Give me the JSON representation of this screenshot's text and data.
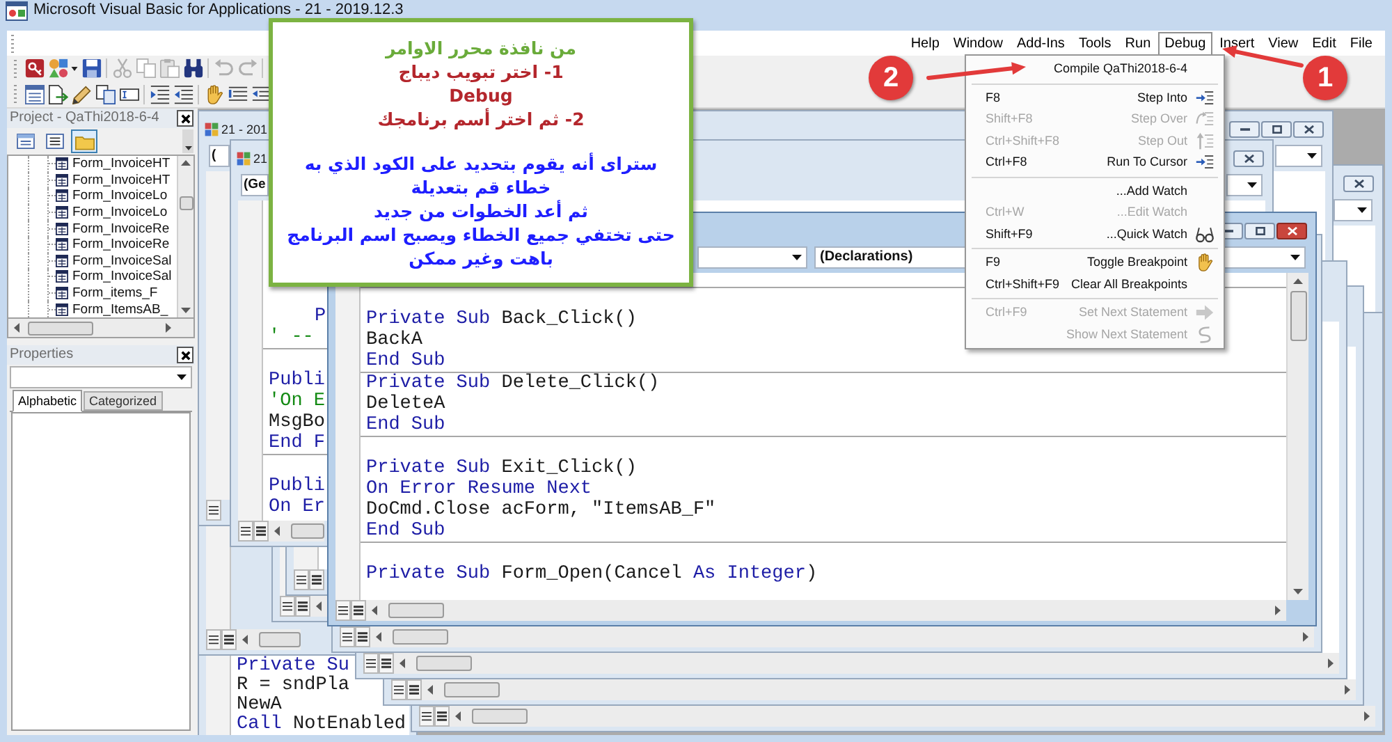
{
  "window": {
    "title": "Microsoft Visual Basic for Applications - 21 - 2019.12.3"
  },
  "menu_bar": [
    {
      "label": "Help",
      "selected": false
    },
    {
      "label": "Window",
      "selected": false
    },
    {
      "label": "Add-Ins",
      "selected": false
    },
    {
      "label": "Tools",
      "selected": false
    },
    {
      "label": "Run",
      "selected": false
    },
    {
      "label": "Debug",
      "selected": true
    },
    {
      "label": "Insert",
      "selected": false
    },
    {
      "label": "View",
      "selected": false
    },
    {
      "label": "Edit",
      "selected": false
    },
    {
      "label": "File",
      "selected": false
    }
  ],
  "toolbars": [
    [
      {
        "disabled": false
      },
      {
        "disabled": false,
        "dropdown": true
      },
      {
        "disabled": false
      },
      {
        "disabled": true
      },
      {
        "disabled": true
      },
      {
        "disabled": true
      },
      {
        "disabled": false
      },
      {
        "disabled": true
      },
      {
        "disabled": true
      }
    ],
    [
      {
        "disabled": false
      },
      {
        "disabled": false
      },
      {
        "disabled": false
      },
      {
        "disabled": false
      },
      {
        "disabled": false
      },
      {
        "disabled": false
      },
      {
        "disabled": false
      },
      {
        "disabled": false
      },
      {
        "disabled": false
      },
      {
        "disabled": false
      }
    ]
  ],
  "project": {
    "title": "Project - QaThi2018-6-4",
    "toolbar": [
      {
        "selected": false
      },
      {
        "selected": false
      },
      {
        "selected": true
      }
    ],
    "items": [
      "Form_InvoiceHT",
      "Form_InvoiceHT",
      "Form_InvoiceLo",
      "Form_InvoiceLo",
      "Form_InvoiceRe",
      "Form_InvoiceRe",
      "Form_InvoiceSal",
      "Form_InvoiceSal",
      "Form_items_F",
      "Form_ItemsAB_"
    ]
  },
  "properties": {
    "title": "Properties",
    "tabs": [
      {
        "label": "Alphabetic",
        "selected": true
      },
      {
        "label": "Categorized",
        "selected": false
      }
    ]
  },
  "code_windows": [
    {
      "title": "21 - 201",
      "active": false,
      "object_combo": "("
    },
    {
      "title": "21",
      "active": false,
      "object_combo": "(Ge",
      "lines": [
        {
          "kind": "code",
          "tokens": [
            {
              "kind": "keyword",
              "text": "P"
            }
          ]
        },
        {
          "kind": "code",
          "tokens": [
            {
              "kind": "comment",
              "text": "' --"
            }
          ]
        },
        {
          "kind": "separator"
        },
        {
          "kind": "blank"
        },
        {
          "kind": "code",
          "tokens": [
            {
              "kind": "keyword",
              "text": "Publi"
            }
          ]
        },
        {
          "kind": "code",
          "tokens": [
            {
              "kind": "comment",
              "text": "'On E"
            }
          ]
        },
        {
          "kind": "code",
          "tokens": [
            {
              "kind": "plain",
              "text": "MsgBo"
            }
          ]
        },
        {
          "kind": "code",
          "tokens": [
            {
              "kind": "keyword",
              "text": "End F"
            }
          ]
        },
        {
          "kind": "separator"
        },
        {
          "kind": "blank"
        },
        {
          "kind": "code",
          "tokens": [
            {
              "kind": "keyword",
              "text": "Publi"
            }
          ]
        },
        {
          "kind": "code",
          "tokens": [
            {
              "kind": "keyword",
              "text": "On Er"
            }
          ]
        }
      ]
    },
    {
      "active": false
    },
    {
      "active": true,
      "procedure_combo": "(Declarations)",
      "lines": [
        {
          "kind": "separator"
        },
        {
          "kind": "blank"
        },
        {
          "kind": "code",
          "tokens": [
            {
              "kind": "keyword",
              "text": "Private Sub"
            },
            {
              "kind": "plain",
              "text": " Back_Click()"
            }
          ]
        },
        {
          "kind": "code",
          "tokens": [
            {
              "kind": "plain",
              "text": "BackA"
            }
          ]
        },
        {
          "kind": "code",
          "tokens": [
            {
              "kind": "keyword",
              "text": "End Sub"
            }
          ]
        },
        {
          "kind": "separator"
        },
        {
          "kind": "code",
          "tokens": [
            {
              "kind": "keyword",
              "text": "Private Sub"
            },
            {
              "kind": "plain",
              "text": " Delete_Click()"
            }
          ]
        },
        {
          "kind": "code",
          "tokens": [
            {
              "kind": "plain",
              "text": "DeleteA"
            }
          ]
        },
        {
          "kind": "code",
          "tokens": [
            {
              "kind": "keyword",
              "text": "End Sub"
            }
          ]
        },
        {
          "kind": "separator"
        },
        {
          "kind": "blank"
        },
        {
          "kind": "code",
          "tokens": [
            {
              "kind": "keyword",
              "text": "Private Sub"
            },
            {
              "kind": "plain",
              "text": " Exit_Click()"
            }
          ]
        },
        {
          "kind": "code",
          "tokens": [
            {
              "kind": "keyword",
              "text": "On Error Resume Next"
            }
          ]
        },
        {
          "kind": "code",
          "tokens": [
            {
              "kind": "plain",
              "text": "DoCmd.Close acForm, \"ItemsAB_F\""
            }
          ]
        },
        {
          "kind": "code",
          "tokens": [
            {
              "kind": "keyword",
              "text": "End Sub"
            }
          ]
        },
        {
          "kind": "separator"
        },
        {
          "kind": "blank"
        },
        {
          "kind": "code",
          "tokens": [
            {
              "kind": "keyword",
              "text": "Private Sub"
            },
            {
              "kind": "plain",
              "text": " Form_Open(Cancel "
            },
            {
              "kind": "keyword",
              "text": "As Integer"
            },
            {
              "kind": "plain",
              "text": ")"
            }
          ]
        }
      ]
    }
  ],
  "lower_window": {
    "lines": [
      {
        "kind": "code",
        "tokens": [
          {
            "kind": "keyword",
            "text": "Private Su"
          }
        ]
      },
      {
        "kind": "code",
        "tokens": [
          {
            "kind": "plain",
            "text": "R = sndPla"
          }
        ]
      },
      {
        "kind": "code",
        "tokens": [
          {
            "kind": "plain",
            "text": "NewA"
          }
        ]
      },
      {
        "kind": "code",
        "tokens": [
          {
            "kind": "keyword",
            "text": "Call"
          },
          {
            "kind": "plain",
            "text": " NotEnabled"
          }
        ]
      }
    ]
  },
  "debug_menu": [
    {
      "kind": "command",
      "label": "Compile QaThi2018-6-4",
      "disabled": false
    },
    {
      "kind": "separator"
    },
    {
      "kind": "command",
      "shortcut": "F8",
      "label": "Step Into",
      "disabled": false
    },
    {
      "kind": "command",
      "shortcut": "Shift+F8",
      "label": "Step Over",
      "disabled": true
    },
    {
      "kind": "command",
      "shortcut": "Ctrl+Shift+F8",
      "label": "Step Out",
      "disabled": true
    },
    {
      "kind": "command",
      "shortcut": "Ctrl+F8",
      "label": "Run To Cursor",
      "disabled": false
    },
    {
      "kind": "separator"
    },
    {
      "kind": "command",
      "label": "...Add Watch",
      "disabled": false
    },
    {
      "kind": "command",
      "shortcut": "Ctrl+W",
      "label": "...Edit Watch",
      "disabled": true
    },
    {
      "kind": "command",
      "shortcut": "Shift+F9",
      "label": "...Quick Watch",
      "disabled": false
    },
    {
      "kind": "separator"
    },
    {
      "kind": "command",
      "shortcut": "F9",
      "label": "Toggle Breakpoint",
      "disabled": false
    },
    {
      "kind": "command",
      "shortcut": "Ctrl+Shift+F9",
      "label": "Clear All Breakpoints",
      "disabled": false
    },
    {
      "kind": "separator"
    },
    {
      "kind": "command",
      "shortcut": "Ctrl+F9",
      "label": "Set Next Statement",
      "disabled": true
    },
    {
      "kind": "command",
      "label": "Show Next Statement",
      "disabled": true
    }
  ],
  "callout": {
    "heading": "من نافذة محرر الاوامر",
    "steps": [
      "1- اختر تبويب ديباج",
      "Debug",
      "2- ثم اختر أسم برنامجك"
    ],
    "notes": [
      "ستراى أنه يقوم بتحديد على الكود الذي به خطاء قم بتعديلة",
      "ثم أعد الخطوات من جديد",
      "حتى تختفي جميع الخطاء ويصبح اسم البرنامج باهت وغير ممكن"
    ]
  },
  "markers": [
    {
      "label": "2"
    },
    {
      "label": "1"
    }
  ]
}
